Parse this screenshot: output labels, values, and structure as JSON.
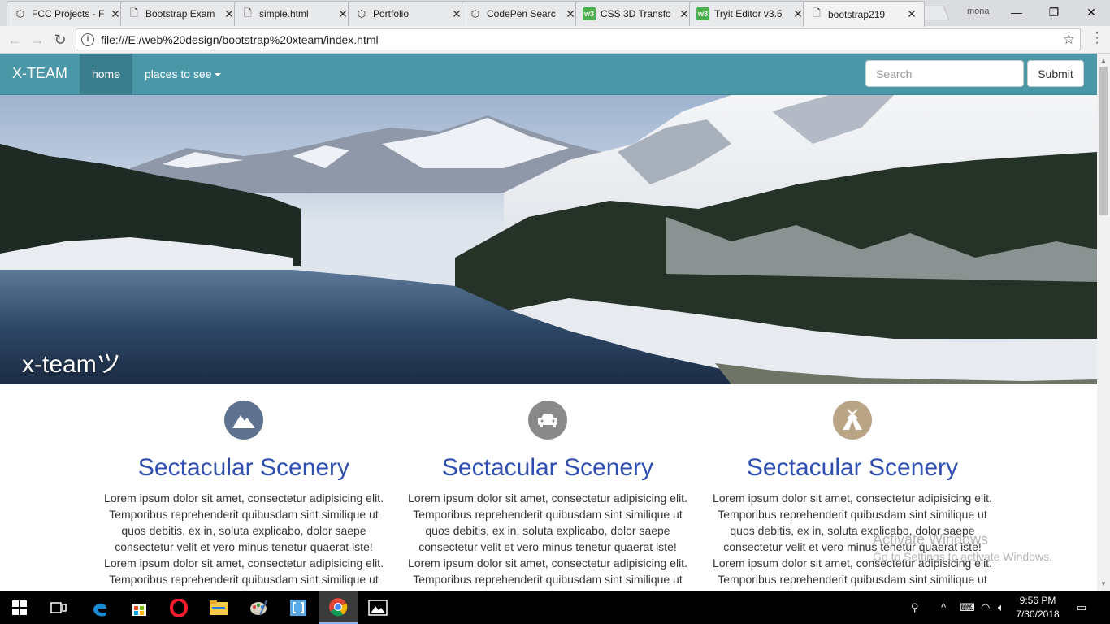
{
  "browser": {
    "tabs": [
      {
        "title": "FCC Projects - F",
        "icon": "codepen-icon"
      },
      {
        "title": "Bootstrap Exam",
        "icon": "page-icon"
      },
      {
        "title": "simple.html",
        "icon": "page-icon"
      },
      {
        "title": "Portfolio",
        "icon": "codepen-icon"
      },
      {
        "title": "CodePen Searc",
        "icon": "codepen-icon"
      },
      {
        "title": "CSS 3D Transfo",
        "icon": "w3-icon"
      },
      {
        "title": "Tryit Editor v3.5",
        "icon": "w3-icon"
      },
      {
        "title": "bootstrap219",
        "icon": "page-icon"
      }
    ],
    "w3_glyph": "w3",
    "profile_name": "mona",
    "url": "file:///E:/web%20design/bootstrap%20xteam/index.html"
  },
  "navbar": {
    "brand": "X-TEAM",
    "home": "home",
    "places": "places to see",
    "search_placeholder": "Search",
    "submit": "Submit",
    "color": "#4a97a8"
  },
  "hero": {
    "caption": "x-teamツ"
  },
  "features": [
    {
      "icon": "mountain-icon",
      "color": "#5e7290",
      "title": "Sectacular Scenery",
      "text": "Lorem ipsum dolor sit amet, consectetur adipisicing elit. Temporibus reprehenderit quibusdam sint similique ut quos debitis, ex in, soluta explicabo, dolor saepe consectetur velit et vero minus tenetur quaerat iste! Lorem ipsum dolor sit amet, consectetur adipisicing elit. Temporibus reprehenderit quibusdam sint similique ut"
    },
    {
      "icon": "car-icon",
      "color": "#8a8a8a",
      "title": "Sectacular Scenery",
      "text": "Lorem ipsum dolor sit amet, consectetur adipisicing elit. Temporibus reprehenderit quibusdam sint similique ut quos debitis, ex in, soluta explicabo, dolor saepe consectetur velit et vero minus tenetur quaerat iste! Lorem ipsum dolor sit amet, consectetur adipisicing elit. Temporibus reprehenderit quibusdam sint similique ut"
    },
    {
      "icon": "tent-icon",
      "color": "#b9a586",
      "title": "Sectacular Scenery",
      "text": "Lorem ipsum dolor sit amet, consectetur adipisicing elit. Temporibus reprehenderit quibusdam sint similique ut quos debitis, ex in, soluta explicabo, dolor saepe consectetur velit et vero minus tenetur quaerat iste! Lorem ipsum dolor sit amet, consectetur adipisicing elit. Temporibus reprehenderit quibusdam sint similique ut"
    }
  ],
  "watermark": {
    "line1": "Activate Windows",
    "line2": "Go to Settings to activate Windows."
  },
  "taskbar": {
    "time": "9:56 PM",
    "date": "7/30/2018"
  }
}
